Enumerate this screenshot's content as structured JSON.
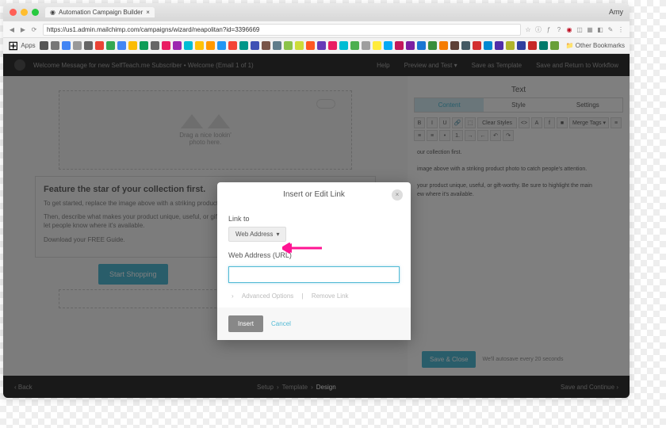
{
  "browser": {
    "tab_title": "Automation Campaign Builder",
    "url": "https://us1.admin.mailchimp.com/campaigns/wizard/neapolitan?id=3396669",
    "user": "Amy",
    "bookmarks_label": "Apps",
    "other_bookmarks": "Other Bookmarks"
  },
  "topbar": {
    "breadcrumb": "Welcome Message for new SelfTeach.me Subscriber • Welcome (Email 1 of 1)",
    "links": [
      "Help",
      "Preview and Test",
      "Save as Template",
      "Save and Return to Workflow"
    ]
  },
  "editor": {
    "placeholder_text1": "Drag a nice lookin'",
    "placeholder_text2": "photo here.",
    "feature_title": "Feature the star of your collection first.",
    "feature_p1": "To get started, replace the image above with a striking product photo to catch people's attention.",
    "feature_p2": "Then, describe what makes your product unique, useful, or gift-worthy. Be sure to highlight the main features, and let people know where it's available.",
    "feature_p3": "Download your FREE Guide.",
    "shop_btn": "Start Shopping"
  },
  "sidebar": {
    "title": "Text",
    "tabs": [
      "Content",
      "Style",
      "Settings"
    ],
    "body_l1": "our collection first.",
    "body_l2": "image above with a striking product photo to catch people's attention.",
    "body_l3": "your product unique, useful, or gift-worthy. Be sure to highlight the main",
    "body_l4": "ew where it's available.",
    "save_btn": "Save & Close",
    "autosave": "We'll autosave every 20 seconds"
  },
  "footer": {
    "back": "Back",
    "steps": [
      "Setup",
      "Template",
      "Design"
    ],
    "continue": "Save and Continue"
  },
  "modal": {
    "title": "Insert or Edit Link",
    "link_to_label": "Link to",
    "link_to_value": "Web Address",
    "url_label": "Web Address (URL)",
    "url_value": "",
    "advanced": "Advanced Options",
    "remove": "Remove Link",
    "insert": "Insert",
    "cancel": "Cancel"
  }
}
